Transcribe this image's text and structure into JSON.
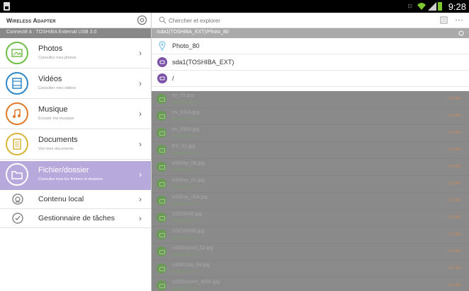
{
  "status_bar": {
    "time": "9:28",
    "signal_text": "⊡"
  },
  "sidebar": {
    "title": "Wireless Adapter",
    "connection": "Connecté à : TOSHIBA External USB 3.0",
    "categories": [
      {
        "label": "Photos",
        "sub": "Consulter mes photos",
        "color": "#6ebd45",
        "icon": "photo-icon"
      },
      {
        "label": "Vidéos",
        "sub": "Consulter mes vidéos",
        "color": "#2e88c8",
        "icon": "video-icon"
      },
      {
        "label": "Musique",
        "sub": "Écouter ma musique",
        "color": "#e07a2a",
        "icon": "music-icon"
      },
      {
        "label": "Documents",
        "sub": "Voir mes documents",
        "color": "#d9b43a",
        "icon": "document-icon"
      },
      {
        "label": "Fichier/dossier",
        "sub": "Consulter tous les fichiers et dossiers",
        "color": "#ffffff",
        "icon": "folder-icon"
      }
    ],
    "extras": [
      {
        "label": "Contenu local",
        "icon": "local-content-icon"
      },
      {
        "label": "Gestionnaire de tâches",
        "icon": "task-manager-icon"
      }
    ]
  },
  "search": {
    "placeholder": "Chercher et explorer"
  },
  "path": "/sda1(TOSHIBA_EXT)/Photo_80",
  "nav": [
    {
      "label": "Photo_80",
      "icon": "location-pin-icon"
    },
    {
      "label": "sda1(TOSHIBA_EXT)",
      "icon": "drive-icon"
    },
    {
      "label": "/",
      "icon": "root-drive-icon"
    }
  ],
  "files": [
    {
      "name": "ex_03.jpg",
      "date": "2008/01/12 01:44",
      "size": "2.36 MB"
    },
    {
      "name": "ex_0304.jpg",
      "date": "2008/01/12 01:44",
      "size": "1.43 MB"
    },
    {
      "name": "ex_0303.jpg",
      "date": "2008/01/12 01:44",
      "size": "1.59 MB"
    },
    {
      "name": "EX_01.jpg",
      "date": "2008/01/12 01:44",
      "size": "1.83 MB"
    },
    {
      "name": "e500xp_08.jpg",
      "date": "2008/01/12 01:44",
      "size": "2.00 MB"
    },
    {
      "name": "e300xp_01.jpg",
      "date": "2008/01/12 01:44",
      "size": "2.19 MB"
    },
    {
      "name": "e330sp_004.jpg",
      "date": "2008/01/12 01:44",
      "size": "6.33 MB"
    },
    {
      "name": "DSC0045.jpg",
      "date": "2008/01/12 01:44",
      "size": "2.12 MB"
    },
    {
      "name": "DSC00986.jpg",
      "date": "2008/01/12 01:44",
      "size": "2.72 MB"
    },
    {
      "name": "c4080wzsd_02.jpg",
      "date": "2008/01/12 01:44",
      "size": "2.59 MB"
    },
    {
      "name": "c4040zsp_04.jpg",
      "date": "2008/01/12 01:44",
      "size": "2.57 MB"
    },
    {
      "name": "c2020zoom_4000.jpg",
      "date": "2008/01/12 01:44",
      "size": "2.11 MB"
    }
  ]
}
